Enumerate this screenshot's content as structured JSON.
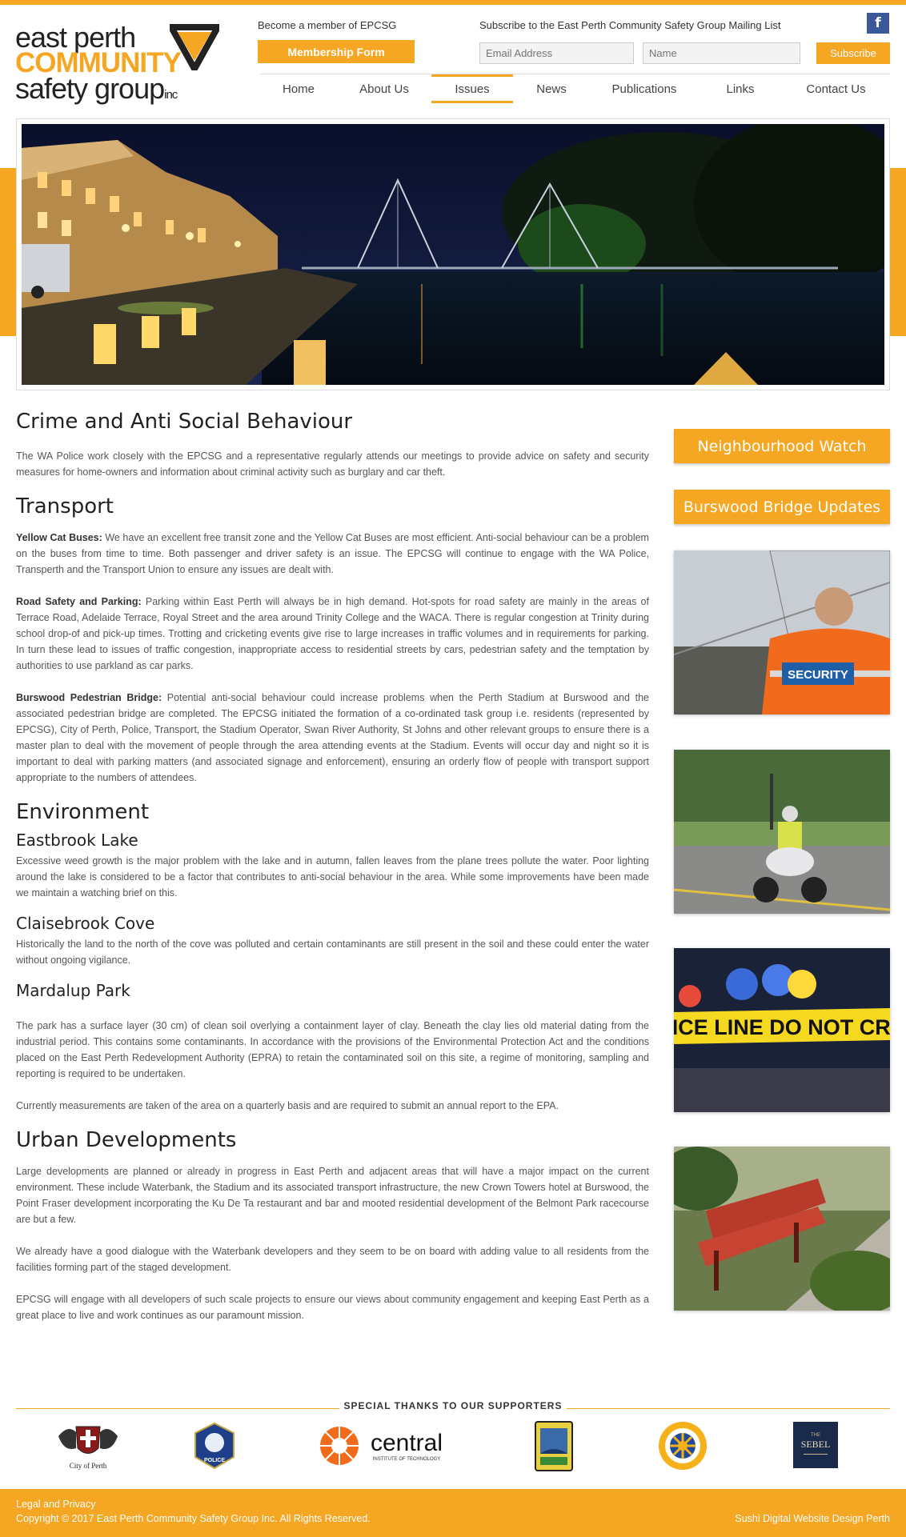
{
  "logo": {
    "line1": "east perth",
    "line2": "COMMUNITY",
    "line3": "safety group",
    "inc": "inc"
  },
  "header": {
    "member_label": "Become a member of EPCSG",
    "member_button": "Membership Form",
    "subscribe_label": "Subscribe to the East Perth Community Safety Group Mailing List",
    "email_placeholder": "Email Address",
    "name_placeholder": "Name",
    "subscribe_button": "Subscribe",
    "facebook": "f"
  },
  "nav": {
    "items": [
      {
        "label": "Home"
      },
      {
        "label": "About Us"
      },
      {
        "label": "Issues"
      },
      {
        "label": "News"
      },
      {
        "label": "Publications"
      },
      {
        "label": "Links"
      },
      {
        "label": "Contact Us"
      }
    ],
    "active": "Issues"
  },
  "main": {
    "crime": {
      "title": "Crime and Anti Social Behaviour",
      "text": "The WA Police work closely with the EPCSG and a representative regularly attends our meetings to provide advice on safety and security measures for home-owners and information about criminal activity such as burglary and car theft."
    },
    "transport": {
      "title": "Transport",
      "p1_label": "Yellow Cat Buses:",
      "p1_text": " We have an excellent free transit zone and the Yellow Cat Buses are most efficient. Anti-social behaviour can be a problem on the buses from time to time. Both passenger and driver safety is an issue. The EPCSG will continue to engage with the WA Police, Transperth and the Transport Union to ensure any issues are dealt with.",
      "p2_label": "Road Safety and Parking:",
      "p2_text": " Parking within East Perth will always be in high demand. Hot-spots for road safety are mainly in the areas of Terrace Road, Adelaide Terrace, Royal Street and the area around Trinity College and the WACA. There is regular congestion at Trinity during school drop-of and pick-up times. Trotting and cricketing events give rise to large increases in traffic volumes and in requirements for parking. In turn these lead to issues of traffic congestion, inappropriate access to residential streets by cars, pedestrian safety and the temptation by authorities to use parkland as car parks.",
      "p3_label": "Burswood Pedestrian Bridge:",
      "p3_text": " Potential anti-social behaviour could increase problems when the Perth Stadium at Burswood and the associated pedestrian bridge are completed. The EPCSG initiated the formation of a co-ordinated task group i.e. residents (represented by EPCSG), City of Perth, Police, Transport, the Stadium Operator, Swan River Authority, St Johns and other relevant groups to ensure there is a master plan to deal with the movement of people through the area attending events at the Stadium. Events will occur day and night so it is important to deal with parking matters (and associated signage and enforcement), ensuring an orderly flow of people with transport support appropriate to the numbers of attendees."
    },
    "environment": {
      "title": "Environment",
      "eastbrook_title": "Eastbrook Lake",
      "eastbrook_text": "Excessive weed growth is the major problem with the lake and in autumn, fallen leaves from the plane trees pollute the water. Poor lighting around the lake is considered to be a factor that contributes to anti-social behaviour in the area. While some improvements have been made we maintain a watching brief on this.",
      "claisebrook_title": "Claisebrook Cove",
      "claisebrook_text": "Historically the land to the north of the cove was polluted and certain contaminants are still present in the soil and these could enter the water without ongoing vigilance.",
      "mardalup_title": "Mardalup Park",
      "mardalup_text1": "The park has a surface layer (30 cm) of clean soil overlying a containment layer of clay. Beneath the clay lies old material dating from the industrial period. This contains some contaminants. In accordance with the provisions of the Environmental Protection Act and the conditions placed on the East Perth Redevelopment Authority (EPRA) to retain the contaminated soil on this site, a regime of monitoring, sampling and reporting is required to be undertaken.",
      "mardalup_text2": "Currently measurements are taken of the area on a quarterly basis and are required to submit an annual report to the EPA."
    },
    "urban": {
      "title": "Urban Developments",
      "p1": "Large developments are planned or already in progress in East Perth and adjacent areas that will have a major impact on the current environment. These include Waterbank, the Stadium and its associated transport infrastructure, the new Crown Towers hotel at Burswood, the Point Fraser development incorporating the Ku De Ta restaurant and bar and mooted residential development of the Belmont Park racecourse are but a few.",
      "p2": "We already have a good dialogue with the Waterbank developers and they seem to be on board with adding value to all residents from the facilities forming part of the staged development.",
      "p3": "EPCSG will engage with all developers of such scale projects to ensure our views about community engagement and keeping East Perth as a great place to live and work continues as our paramount mission."
    }
  },
  "sidebar": {
    "button1": "Neighbourhood Watch",
    "button2": "Burswood Bridge Updates",
    "security_vest": "SECURITY",
    "police_tape": "POLICE LINE DO NOT CROSS"
  },
  "supporters": {
    "title": "SPECIAL THANKS TO OUR SUPPORTERS",
    "city_of_perth": "City of Perth",
    "police": "POLICE",
    "central_name": "central",
    "central_sub": "INSTITUTE OF TECHNOLOGY",
    "sebel_small": "THE",
    "sebel_name": "SEBEL"
  },
  "footer": {
    "legal": "Legal and Privacy",
    "copyright": "Copyright © 2017 East Perth Community Safety Group Inc. All Rights Reserved.",
    "credit": "Sushi Digital Website Design Perth"
  },
  "colors": {
    "accent": "#f5a623",
    "facebook": "#3b5998"
  }
}
